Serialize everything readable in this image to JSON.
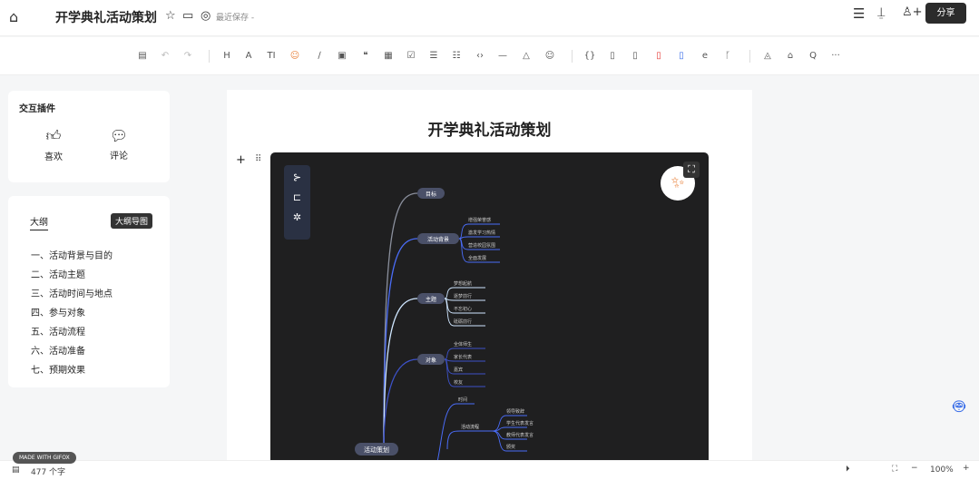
{
  "header": {
    "title": "开学典礼活动策划",
    "save_status": "最近保存 -",
    "share_label": "分享",
    "icons": [
      "home-icon",
      "star-icon",
      "folder-icon",
      "check-circle-icon",
      "menu-icon",
      "presentation-icon",
      "add-user-icon"
    ]
  },
  "toolbar": {
    "icons": [
      "save-icon",
      "undo-icon",
      "redo-icon",
      "heading-icon",
      "font-size-icon",
      "text-icon",
      "emoji-color-icon",
      "link-icon",
      "image-icon",
      "quote-icon",
      "table-icon",
      "checkbox-icon",
      "bullet-list-icon",
      "ordered-list-icon",
      "code-icon",
      "divider-icon",
      "highlight-icon",
      "emoji-icon",
      "code-block-icon",
      "file-icon",
      "attachment-icon",
      "pdf-icon",
      "word-icon",
      "embed-icon",
      "branch-icon",
      "brush-icon",
      "format-painter-icon",
      "search-icon",
      "more-icon"
    ],
    "glyphs": [
      "▤",
      "↶",
      "↷",
      "H",
      "A",
      "TI",
      "☺",
      "∕",
      "▣",
      "❝",
      "▦",
      "☑",
      "☰",
      "☷",
      "‹›",
      "—",
      "△",
      "☺",
      "{}",
      "▯",
      "▯",
      "▯",
      "▯",
      "e",
      "ᚴ",
      "◬",
      "⌂",
      "Q",
      "···"
    ]
  },
  "plugins": {
    "title": "交互插件",
    "like": "喜欢",
    "comment": "评论"
  },
  "outline": {
    "tab_outline": "大纲",
    "tab_mindmap": "大纲导图",
    "items": [
      "一、活动背景与目的",
      "二、活动主题",
      "三、活动时间与地点",
      "四、参与对象",
      "五、活动流程",
      "六、活动准备",
      "七、预期效果"
    ]
  },
  "document": {
    "title": "开学典礼活动策划"
  },
  "mindmap": {
    "root": "活动策划",
    "branches": [
      {
        "label": "目标",
        "leaves": []
      },
      {
        "label": "活动背景",
        "leaves": [
          "增强荣誉感",
          "激发学习热情",
          "营造校园氛围",
          "全面发展"
        ]
      },
      {
        "label": "主题",
        "leaves": [
          "梦想起航",
          "逐梦前行",
          "不忘初心",
          "砥砺前行"
        ]
      },
      {
        "label": "对象",
        "leaves": [
          "全体师生",
          "家长代表",
          "嘉宾",
          "校友"
        ]
      }
    ],
    "lower": {
      "leaf": "时间",
      "node": "活动流程",
      "leaves": [
        "领导致辞",
        "学生代表发言",
        "教师代表发言",
        "颁奖"
      ]
    }
  },
  "footer": {
    "word_count": "477 个字",
    "zoom": "100%",
    "badge": "MADE WITH GIFOX"
  },
  "colors": {
    "share_bg": "#2b2b2b",
    "mindmap_bg": "#1f1f20",
    "accent_blue": "#4a6cf7"
  }
}
